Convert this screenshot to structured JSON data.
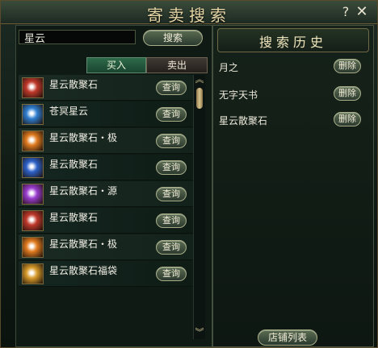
{
  "window": {
    "title": "寄卖搜索",
    "help_label": "?",
    "close_label": "✕"
  },
  "search": {
    "value": "星云",
    "button_label": "搜索"
  },
  "tabs": {
    "buy_label": "买入",
    "sell_label": "卖出",
    "active": "buy"
  },
  "results": {
    "query_label": "查询",
    "items": [
      {
        "name": "星云散聚石",
        "icon": "red-nebula-stone-icon",
        "color": "#c0392b"
      },
      {
        "name": "苍冥星云",
        "icon": "ice-crystal-icon",
        "color": "#2f7fd1"
      },
      {
        "name": "星云散聚石・极",
        "icon": "fire-nebula-stone-icon",
        "color": "#e07b1f"
      },
      {
        "name": "星云散聚石",
        "icon": "blue-nebula-stone-icon",
        "color": "#2d62c9"
      },
      {
        "name": "星云散聚石・源",
        "icon": "purple-nebula-stone-icon",
        "color": "#9a3ccf"
      },
      {
        "name": "星云散聚石",
        "icon": "red-nebula-stone-icon",
        "color": "#c0392b"
      },
      {
        "name": "星云散聚石・极",
        "icon": "fire-nebula-stone-icon",
        "color": "#e07b1f"
      },
      {
        "name": "星云散聚石福袋",
        "icon": "gift-bag-icon",
        "color": "#d69a2a"
      }
    ]
  },
  "scroll": {
    "up_label": "︽",
    "down_label": "︾"
  },
  "history": {
    "title": "搜索历史",
    "delete_label": "删除",
    "items": [
      {
        "label": "月之"
      },
      {
        "label": "无字天书"
      },
      {
        "label": "星云散聚石"
      }
    ]
  },
  "footer": {
    "shop_list_label": "店铺列表"
  }
}
